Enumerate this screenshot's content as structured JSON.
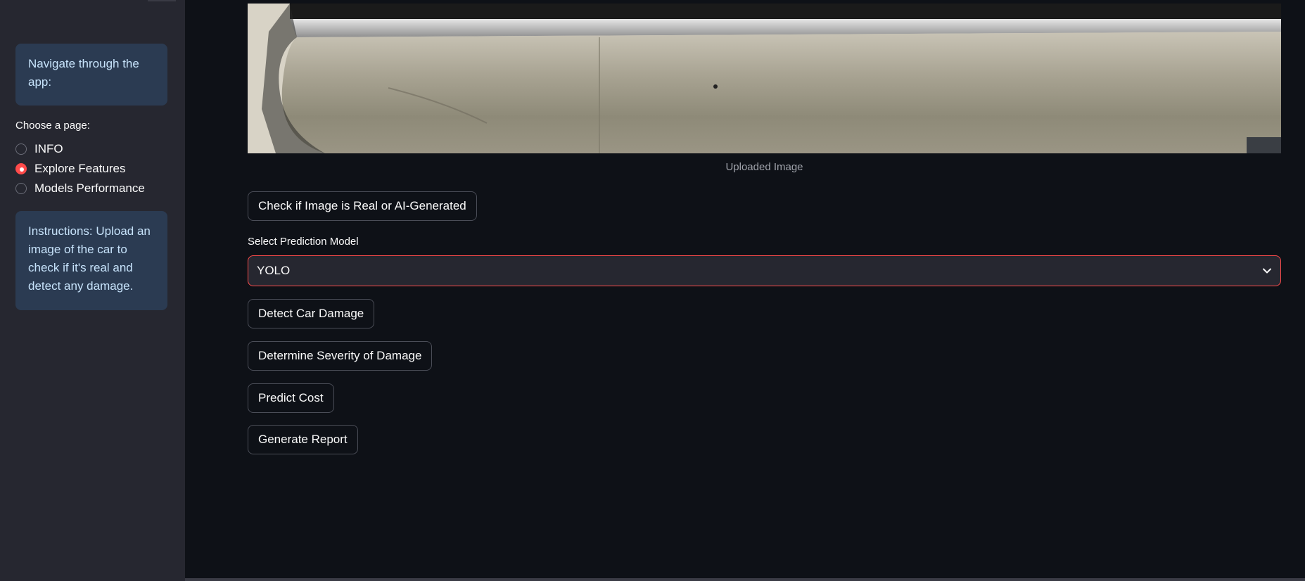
{
  "sidebar": {
    "nav_text": "Navigate through the app:",
    "radio_label": "Choose a page:",
    "options": [
      {
        "label": "INFO",
        "selected": false
      },
      {
        "label": "Explore Features",
        "selected": true
      },
      {
        "label": "Models Performance",
        "selected": false
      }
    ],
    "instructions": "Instructions: Upload an image of the car to check if it's real and detect any damage."
  },
  "main": {
    "image_caption": "Uploaded Image",
    "check_button": "Check if Image is Real or AI-Generated",
    "select_label": "Select Prediction Model",
    "select_value": "YOLO",
    "detect_button": "Detect Car Damage",
    "severity_button": "Determine Severity of Damage",
    "cost_button": "Predict Cost",
    "report_button": "Generate Report"
  },
  "colors": {
    "accent": "#ff4b4b",
    "background": "#0e1117",
    "sidebar": "#262730",
    "info_box": "#2b3b52"
  }
}
